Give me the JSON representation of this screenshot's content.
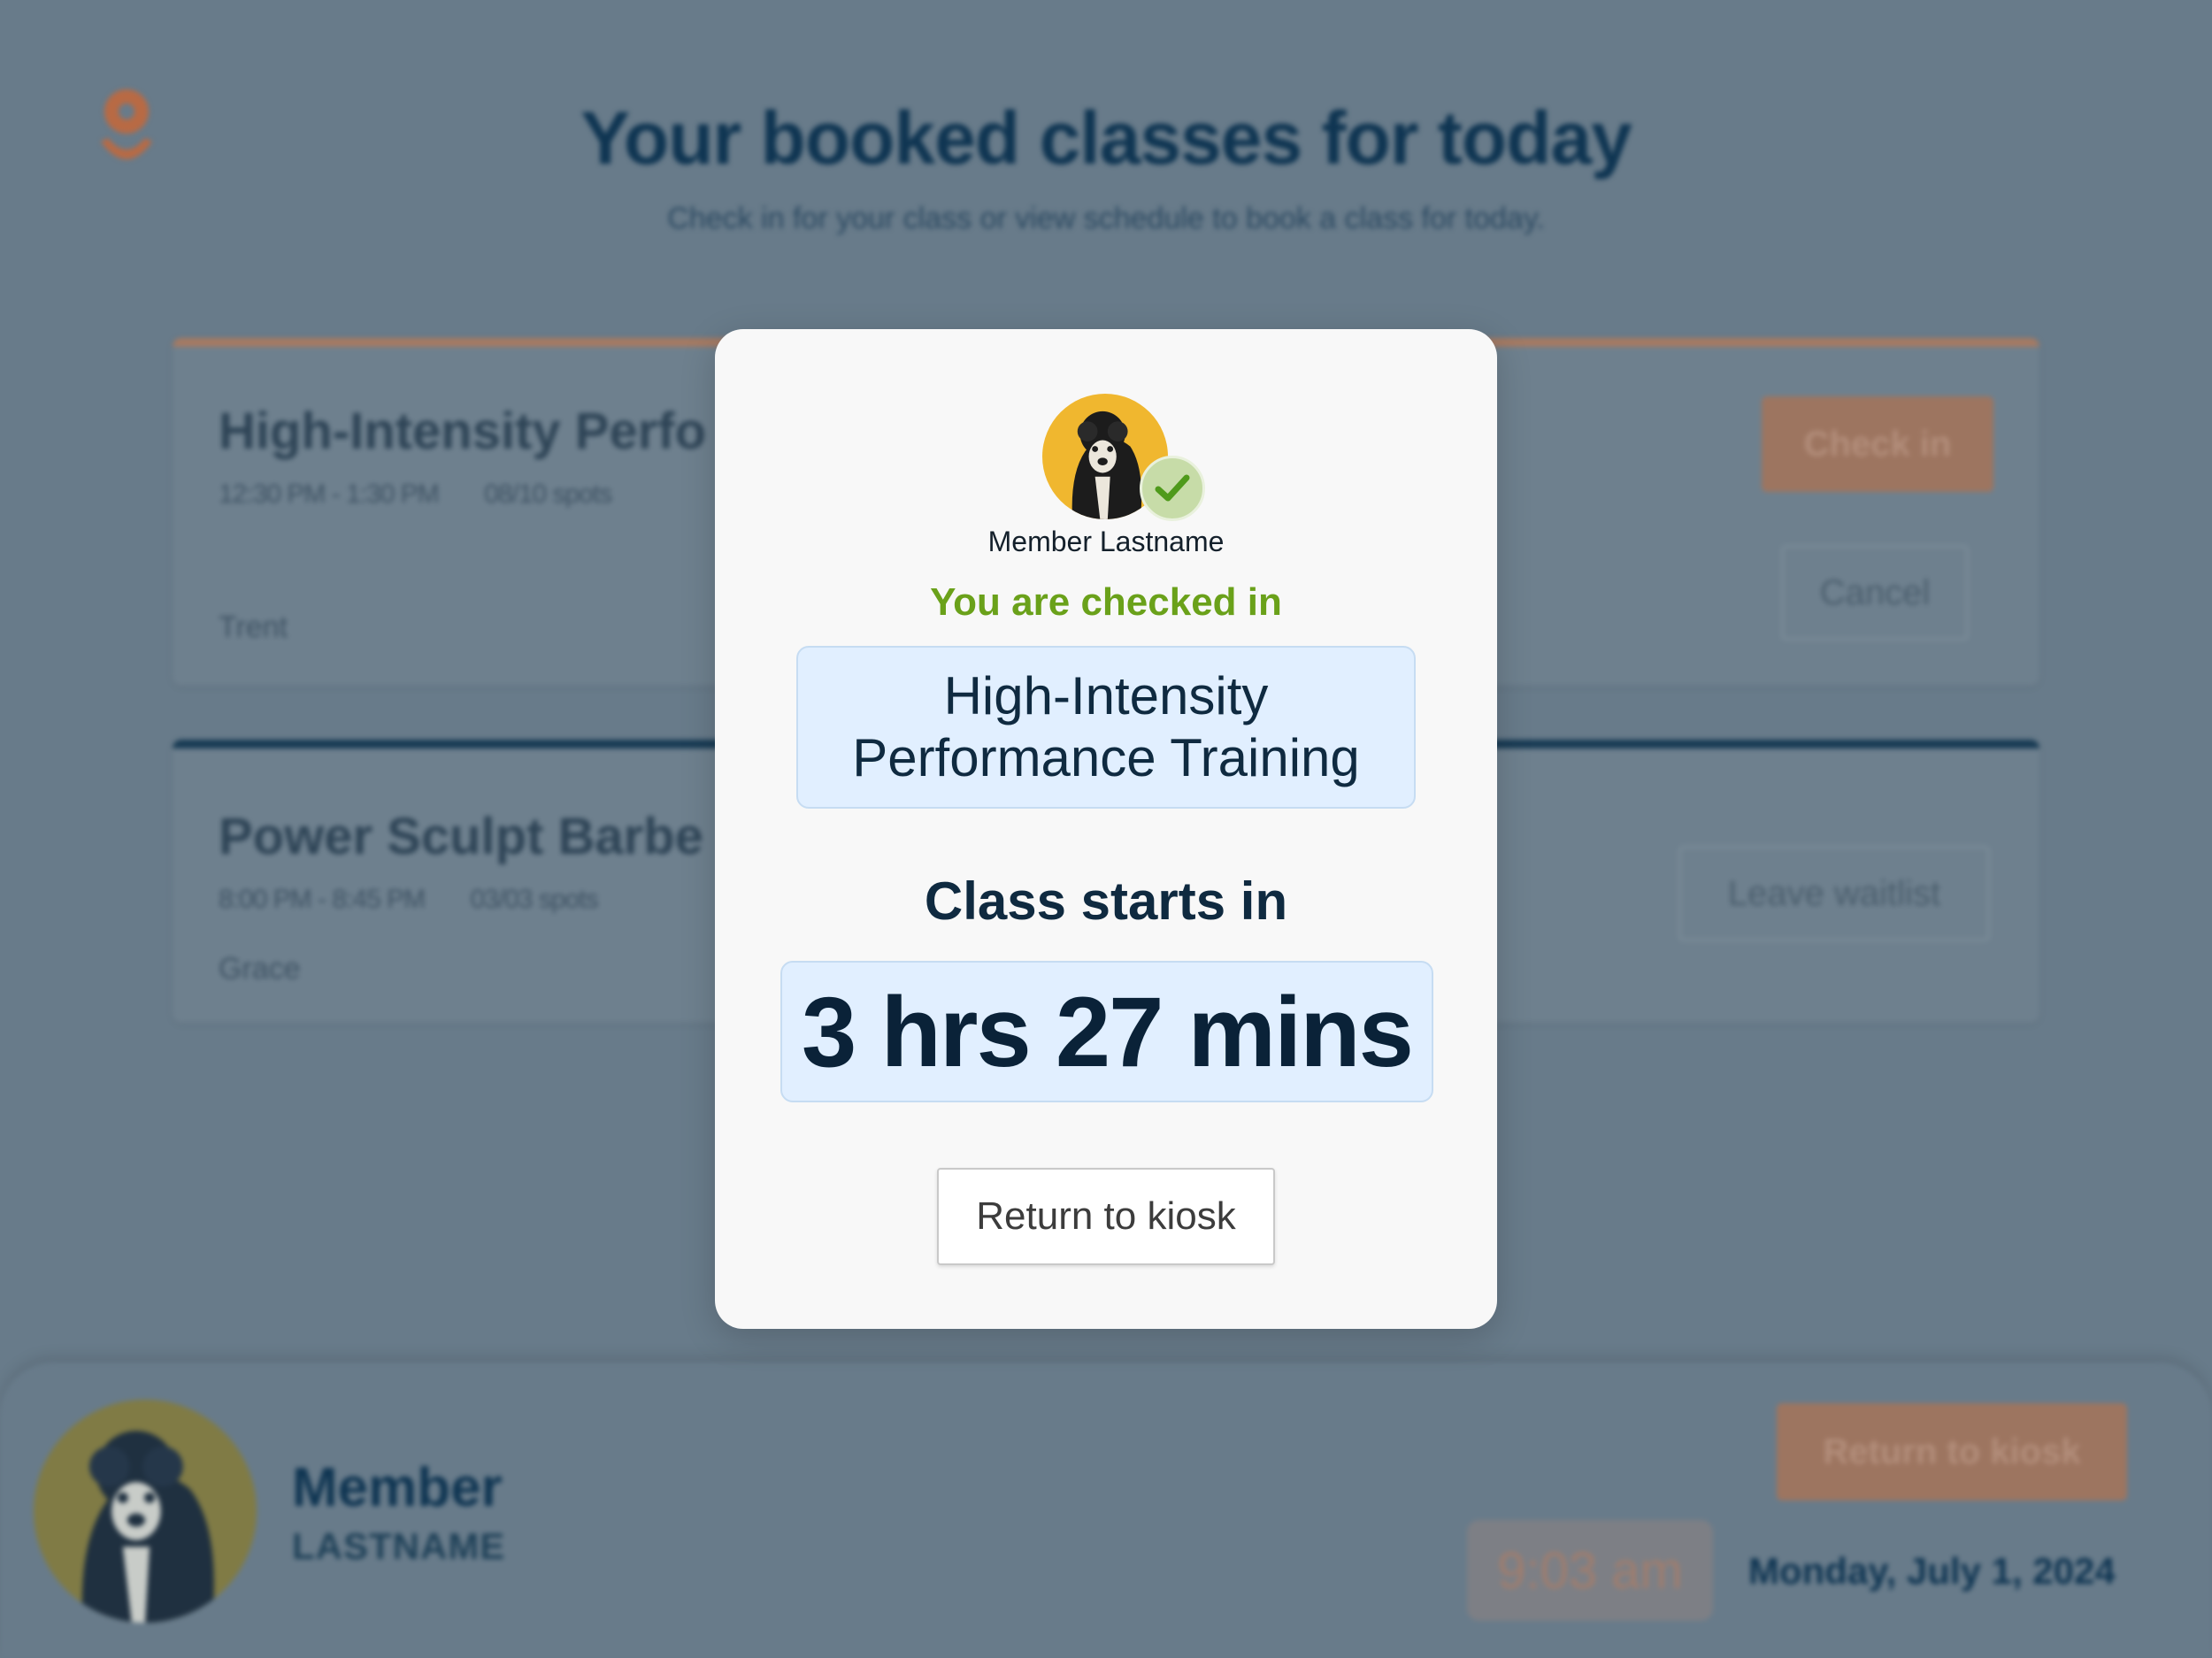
{
  "page": {
    "title": "Your booked classes for today",
    "subtitle": "Check in for your class or view schedule to book a class for today."
  },
  "classes": [
    {
      "name": "High-Intensity Perfo",
      "time": "12:30 PM - 1:30 PM",
      "spots": "08/10 spots",
      "instructor": "Trent",
      "check_in_label": "Check in",
      "cancel_label": "Cancel"
    },
    {
      "name": "Power Sculpt Barbe",
      "time": "8:00 PM - 8:45 PM",
      "spots": "03/03 spots",
      "instructor": "Grace",
      "leave_label": "Leave waitlist"
    }
  ],
  "bottom_bar": {
    "member_first": "Member",
    "member_last": "LASTNAME",
    "return_label": "Return to kiosk",
    "time": "9:03 am",
    "date": "Monday, July 1, 2024"
  },
  "modal": {
    "member_name": "Member Lastname",
    "status": "You are checked in",
    "class_name": "High-Intensity Performance Training",
    "starts_label": "Class starts in",
    "countdown": "3 hrs 27 mins",
    "return_label": "Return to kiosk"
  },
  "colors": {
    "accent": "#c46a3f",
    "navy": "#0f3552",
    "success": "#6aa11a",
    "highlight": "#e1efff"
  },
  "icons": [
    "logo-icon",
    "avatar-dog",
    "check-icon"
  ]
}
